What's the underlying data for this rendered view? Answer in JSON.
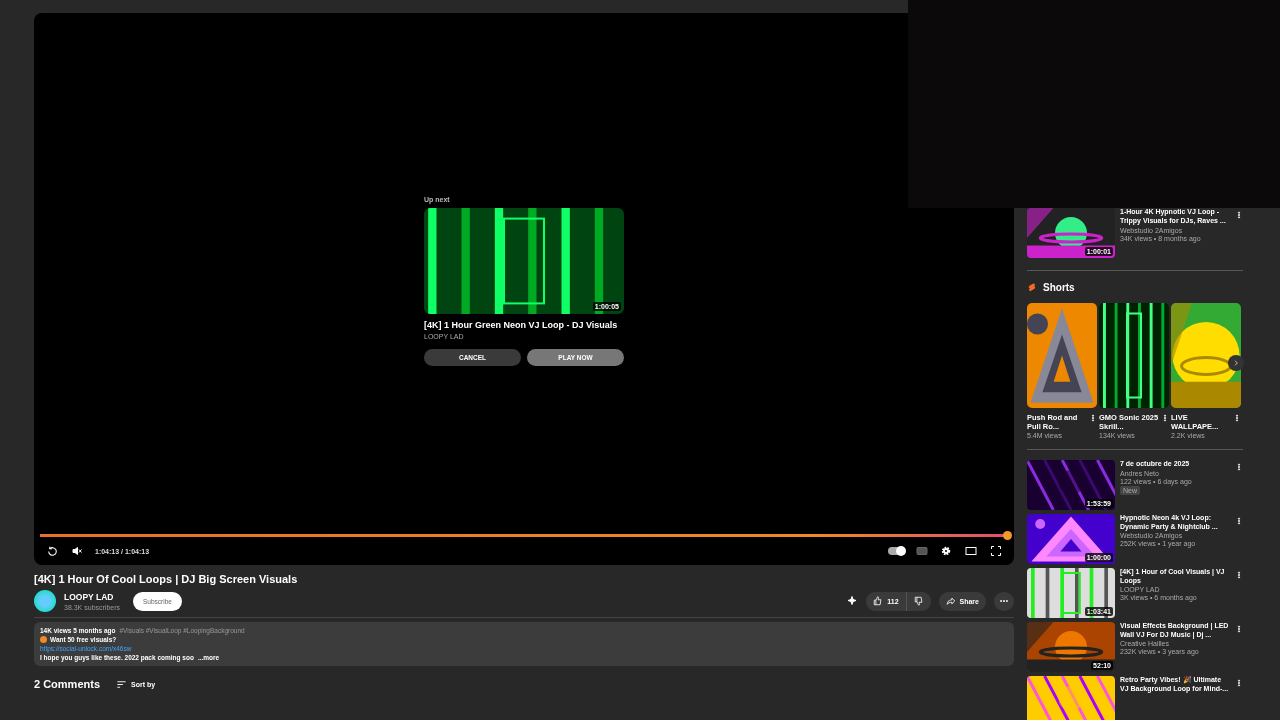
{
  "player": {
    "up_next": {
      "label": "Up next",
      "title": "[4K] 1 Hour Green Neon VJ Loop - DJ Visuals",
      "channel": "LOOPY LAD",
      "duration": "1:00:05",
      "buttons": [
        {
          "label": "CANCEL",
          "kind": "secondary"
        },
        {
          "label": "PLAY NOW",
          "kind": "primary"
        }
      ]
    },
    "progress": {
      "level": 1.0
    },
    "time": "1:04:13 / 1:04:13",
    "muted": true,
    "autoplay": {
      "on": true
    }
  },
  "video": {
    "title": "[4K] 1 Hour Of Cool Loops | DJ Big Screen Visuals",
    "channel": "LOOPY LAD",
    "subscribers": "38.3K subscribers",
    "subscribe_label": "Subscribe",
    "likes": "112",
    "share_label": "Share"
  },
  "description": {
    "stats": "14K views  5 months ago",
    "hashtags": "#Visuals #VisualLoop #LoopingBackground",
    "promo": "Want 50 free visuals?",
    "link": "https://social-unlock.com/x46sw",
    "text": "I hope you guys like these. 2022 pack coming soo",
    "more": "...more"
  },
  "comments": {
    "count": "2 Comments",
    "sort_label": "Sort by"
  },
  "sidebar": {
    "top_video": {
      "title": "1-Hour 4K Hypnotic VJ Loop - Trippy Visuals for DJs, Raves ...",
      "channel": "Webstudio 2Amigos",
      "meta": "34K views • 8 months ago",
      "duration": "1:00:01"
    },
    "shorts_title": "Shorts",
    "shorts": [
      {
        "title": "Push Rod and Pull Ro...",
        "views": "5.4M views"
      },
      {
        "title": "GMO Sonic 2025 Skrill...",
        "views": "134K views"
      },
      {
        "title": "LIVE WALLPAPE...",
        "views": "2.2K views"
      }
    ],
    "videos": [
      {
        "title": "7 de octubre de 2025",
        "channel": "Andres Neto",
        "meta": "122 views • 6 days ago",
        "badge": "New",
        "duration": "1:53:59"
      },
      {
        "title": "Hypnotic Neon 4k VJ Loop: Dynamic Party & Nightclub ...",
        "channel": "Webstudio 2Amigos",
        "meta": "252K views • 1 year ago",
        "duration": "1:00:00"
      },
      {
        "title": "[4K] 1 Hour of Cool Visuals | VJ Loops",
        "channel": "LOOPY LAD",
        "meta": "3K views • 6 months ago",
        "duration": "1:03:41"
      },
      {
        "title": "Visual Effects Background | LED Wall VJ For DJ Music | Dj ...",
        "channel": "Creative Hailles",
        "meta": "232K views • 3 years ago",
        "duration": "52:10"
      },
      {
        "title": "Retro Party Vibes! 🎉 Ultimate VJ Background Loop for Mind-..."
      }
    ]
  }
}
